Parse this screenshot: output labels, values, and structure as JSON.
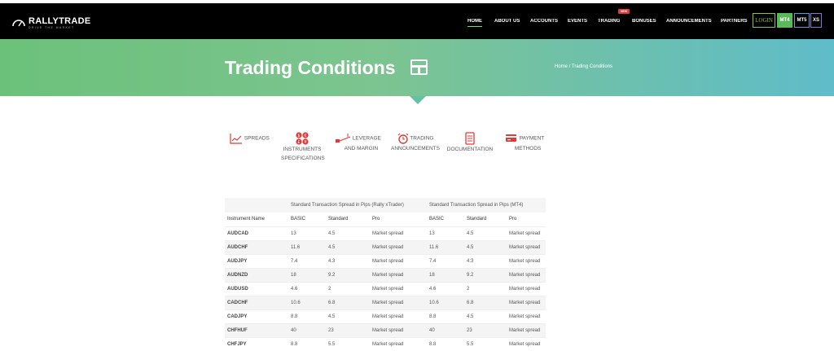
{
  "brand": {
    "name": "RALLYTRADE",
    "tagline": "DRIVE THE MARKET"
  },
  "nav": {
    "items": [
      {
        "label": "HOME"
      },
      {
        "label": "ABOUT US"
      },
      {
        "label": "ACCOUNTS"
      },
      {
        "label": "EVENTS"
      },
      {
        "label": "TRADING"
      },
      {
        "label": "BONUSES"
      },
      {
        "label": "ANNOUNCEMENTS"
      },
      {
        "label": "PARTNERS"
      }
    ],
    "new_badge": "NEW",
    "login": "LOGIN",
    "mt4": "MT4",
    "mt5": "MT5",
    "xs": "XS"
  },
  "banner": {
    "title": "Trading Conditions",
    "breadcrumb_home": "Home",
    "breadcrumb_sep": "/",
    "breadcrumb_current": "Trading Conditions"
  },
  "tabs": [
    {
      "icon": "chart-line-icon",
      "line1": "SPREADS",
      "line2": "",
      "line3": ""
    },
    {
      "icon": "currency-symbols-icon",
      "line1": "",
      "line2": "INSTRUMENTS",
      "line3": "SPECIFICATIONS"
    },
    {
      "icon": "leverage-icon",
      "line1": "LEVERAGE",
      "line2": "AND MARGIN",
      "line3": ""
    },
    {
      "icon": "alarm-clock-icon",
      "line1": "TRADING",
      "line2": "ANNOUNCEMENTS",
      "line3": ""
    },
    {
      "icon": "document-icon",
      "line1": "",
      "line2": "DOCUMENTATION",
      "line3": ""
    },
    {
      "icon": "payment-card-icon",
      "line1": "PAYMENT",
      "line2": "METHODS",
      "line3": ""
    }
  ],
  "table": {
    "group_headers": [
      "",
      "Standard Transaction Spread in Pips (Rally xTrader)",
      "Standard Transaction Spread in Pips (MT4)"
    ],
    "columns": [
      "Instrument Name",
      "BASIC",
      "Standard",
      "Pro",
      "BASIC",
      "Standard",
      "Pro"
    ],
    "rows": [
      [
        "AUDCAD",
        "13",
        "4.5",
        "Market spread",
        "13",
        "4.5",
        "Market spread"
      ],
      [
        "AUDCHF",
        "11.6",
        "4.5",
        "Market spread",
        "11.6",
        "4.5",
        "Market spread"
      ],
      [
        "AUDJPY",
        "7.4",
        "4.3",
        "Market spread",
        "7.4",
        "4.3",
        "Market spread"
      ],
      [
        "AUDNZD",
        "18",
        "9.2",
        "Market spread",
        "18",
        "9.2",
        "Market spread"
      ],
      [
        "AUDUSD",
        "4.6",
        "2",
        "Market spread",
        "4.6",
        "2",
        "Market spread"
      ],
      [
        "CADCHF",
        "10.6",
        "6.8",
        "Market spread",
        "10.6",
        "6.8",
        "Market spread"
      ],
      [
        "CADJPY",
        "8.8",
        "4.5",
        "Market spread",
        "8.8",
        "4.5",
        "Market spread"
      ],
      [
        "CHFHUF",
        "40",
        "23",
        "Market spread",
        "40",
        "23",
        "Market spread"
      ],
      [
        "CHFJPY",
        "8.8",
        "5.5",
        "Market spread",
        "8.8",
        "5.5",
        "Market spread"
      ]
    ]
  },
  "colors": {
    "nav_bg": "#000000",
    "accent_green": "#5cb85c",
    "tab_icon_red": "#e53935",
    "banner_start": "#6bc17a",
    "banner_end": "#5fbcc9"
  }
}
